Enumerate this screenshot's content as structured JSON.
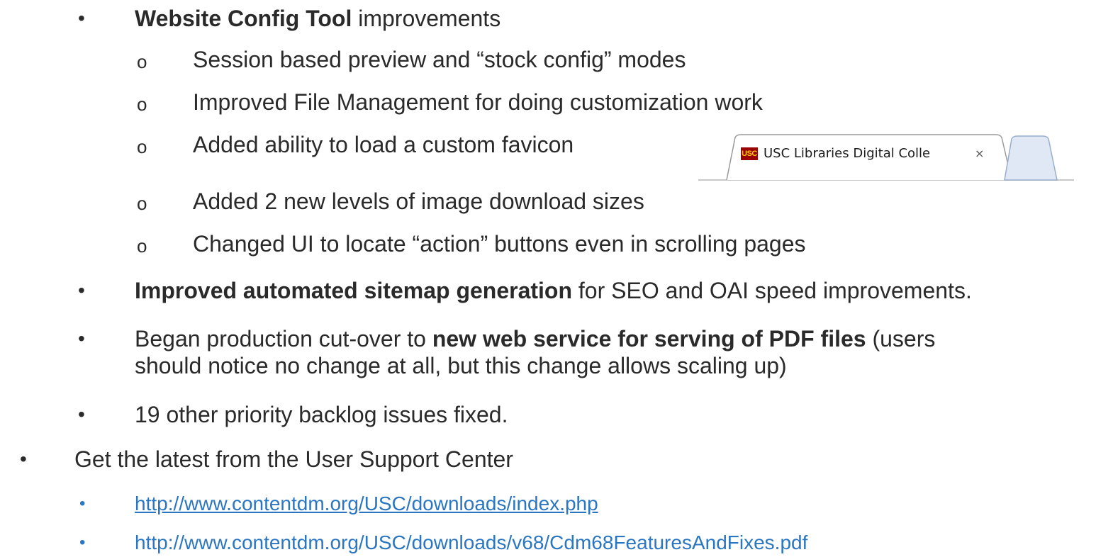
{
  "items": [
    {
      "bullet": "•",
      "bold": "Website Config Tool",
      "text": " improvements"
    },
    {
      "bullet": "o",
      "text": "Session based preview and “stock config” modes"
    },
    {
      "bullet": "o",
      "text": "Improved File Management for doing customization work"
    },
    {
      "bullet": "o",
      "text": "Added ability to load a custom favicon"
    },
    {
      "bullet": "o",
      "text": "Added 2 new levels of image download sizes"
    },
    {
      "bullet": "o",
      "text": "Changed UI to locate “action” buttons even in scrolling pages"
    },
    {
      "bullet": "•",
      "bold": "Improved automated sitemap generation",
      "text": " for SEO and OAI speed improvements."
    },
    {
      "bullet": "•",
      "pre": "Began production cut-over to ",
      "bold": "new web service for serving of PDF files",
      "text": " (users",
      "line2": "should notice no change at all, but this change allows scaling up)"
    },
    {
      "bullet": "•",
      "text": "19 other priority backlog issues fixed."
    },
    {
      "bullet": "•",
      "text": "Get the latest from the User Support Center"
    }
  ],
  "links": [
    {
      "bullet": "•",
      "text": "http://www.contentdm.org/USC/downloads/index.php"
    },
    {
      "bullet": "•",
      "text": "http://www.contentdm.org/USC/downloads/v68/Cdm68FeaturesAndFixes.pdf"
    }
  ],
  "browser_tab": {
    "favicon": "USC",
    "title": "USC Libraries Digital Colle",
    "close": "×"
  }
}
